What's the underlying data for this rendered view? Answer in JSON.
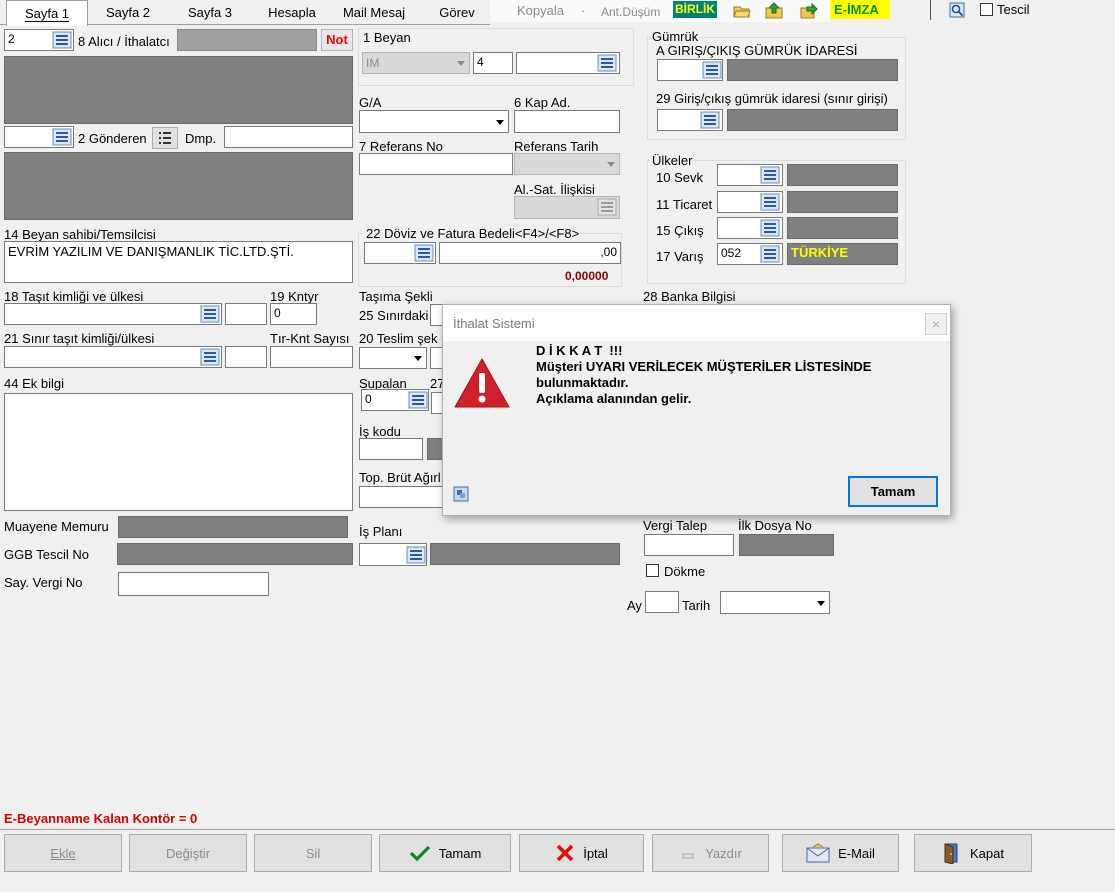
{
  "tabs": [
    "Sayfa 1",
    "Sayfa 2",
    "Sayfa 3",
    "Hesapla",
    "Mail Mesaj",
    "Görev"
  ],
  "toolbar": {
    "kopyala": "Kopyala",
    "dot": "·",
    "ant_dusum": "Ant.Düşüm",
    "birlik": "BİRLİK",
    "eimza": "E-İMZA",
    "tescil": "Tescil"
  },
  "left": {
    "alici_no": "2",
    "alici_label": "8 Alıcı / İthalatcı",
    "not_label": "Not",
    "gonderen_label": "2 Gönderen",
    "dmp_label": "Dmp.",
    "beyan_sahibi_label": "14 Beyan sahibi/Temsilcisi",
    "beyan_sahibi_value": "EVRİM YAZILIM VE DANIŞMANLIK TİC.LTD.ŞTİ.",
    "tasit_label": "18 Taşıt kimliği ve ülkesi",
    "kntyr_label": "19 Kntyr",
    "kntyr_value": "0",
    "sinir_tasit_label": "21 Sınır taşıt kimliği/ülkesi",
    "tir_label": "Tır-Knt Sayısı",
    "ek_bilgi_label": "44 Ek bilgi",
    "muayene_label": "Muayene Memuru",
    "ggb_label": "GGB Tescil No",
    "say_vergi_label": "Say. Vergi No"
  },
  "middle": {
    "beyan_label": "1 Beyan",
    "beyan_type": "IM",
    "beyan_no": "4",
    "ga_label": "G/A",
    "kap_label": "6 Kap Ad.",
    "referans_label": "7 Referans No",
    "referans_tarih_label": "Referans Tarih",
    "al_sat_label": "Al.-Sat. İlişkisi",
    "doviz_label": "22 Döviz ve Fatura Bedeli<F4>/<F8>",
    "doviz_value": ",00",
    "doviz_total": "0,00000",
    "tasima_label": "Taşıma Şekli",
    "sinirdaki_label": "25 Sınırdaki",
    "teslim_label": "20 Teslim şek",
    "supalan_label": "Supalan",
    "supalan_value": "0",
    "label_27": "27",
    "is_kodu_label": "İş kodu",
    "top_brut_label": "Top. Brüt Ağırl",
    "is_plani_label": "İş Planı"
  },
  "right": {
    "gumruk_title": "Gümrük",
    "giris_label": "A GIRIŞ/ÇIKIŞ GÜMRÜK İDARESİ",
    "giris29_label": "29 Giriş/çıkış gümrük idaresi (sınır girişi)",
    "ulkeler_title": "Ülkeler",
    "sevk_label": "10 Sevk",
    "ticaret_label": "11 Ticaret",
    "cikis_label": "15 Çıkış",
    "varis_label": "17 Varış",
    "varis_code": "052",
    "varis_name": "TÜRKİYE",
    "banka_label": "28 Banka Bilgisi",
    "vergi_talep_label": "Vergi Talep",
    "ilk_dosya_label": "İlk Dosya No",
    "dokme_label": "Dökme",
    "ay_label": "Ay",
    "tarih_label": "Tarih"
  },
  "footer": {
    "kontor_text": "E-Beyanname Kalan Kontör = 0"
  },
  "buttons": {
    "ekle": "Ekle",
    "degistir": "Değiştir",
    "sil": "Sil",
    "tamam": "Tamam",
    "iptal": "İptal",
    "yazdir": "Yazdır",
    "email": "E-Mail",
    "kapat": "Kapat"
  },
  "dialog": {
    "title": "İthalat Sistemi",
    "close": "×",
    "line1": "D İ K K A T  !!!",
    "line2": "Müşteri UYARI VERİLECEK MÜŞTERİLER LİSTESİNDE",
    "line3": "bulunmaktadır.",
    "line4": "Açıklama alanından gelir.",
    "ok": "Tamam"
  },
  "colors": {
    "not_red": "#ff0000",
    "kontor_red": "#d40000",
    "birlik_bg": "#008080",
    "birlik_fg": "#ffff00",
    "eimza_bg": "#ffff00",
    "eimza_fg": "#009000",
    "turkiye_fg": "#ffff00",
    "total_fg": "#8b0000"
  }
}
